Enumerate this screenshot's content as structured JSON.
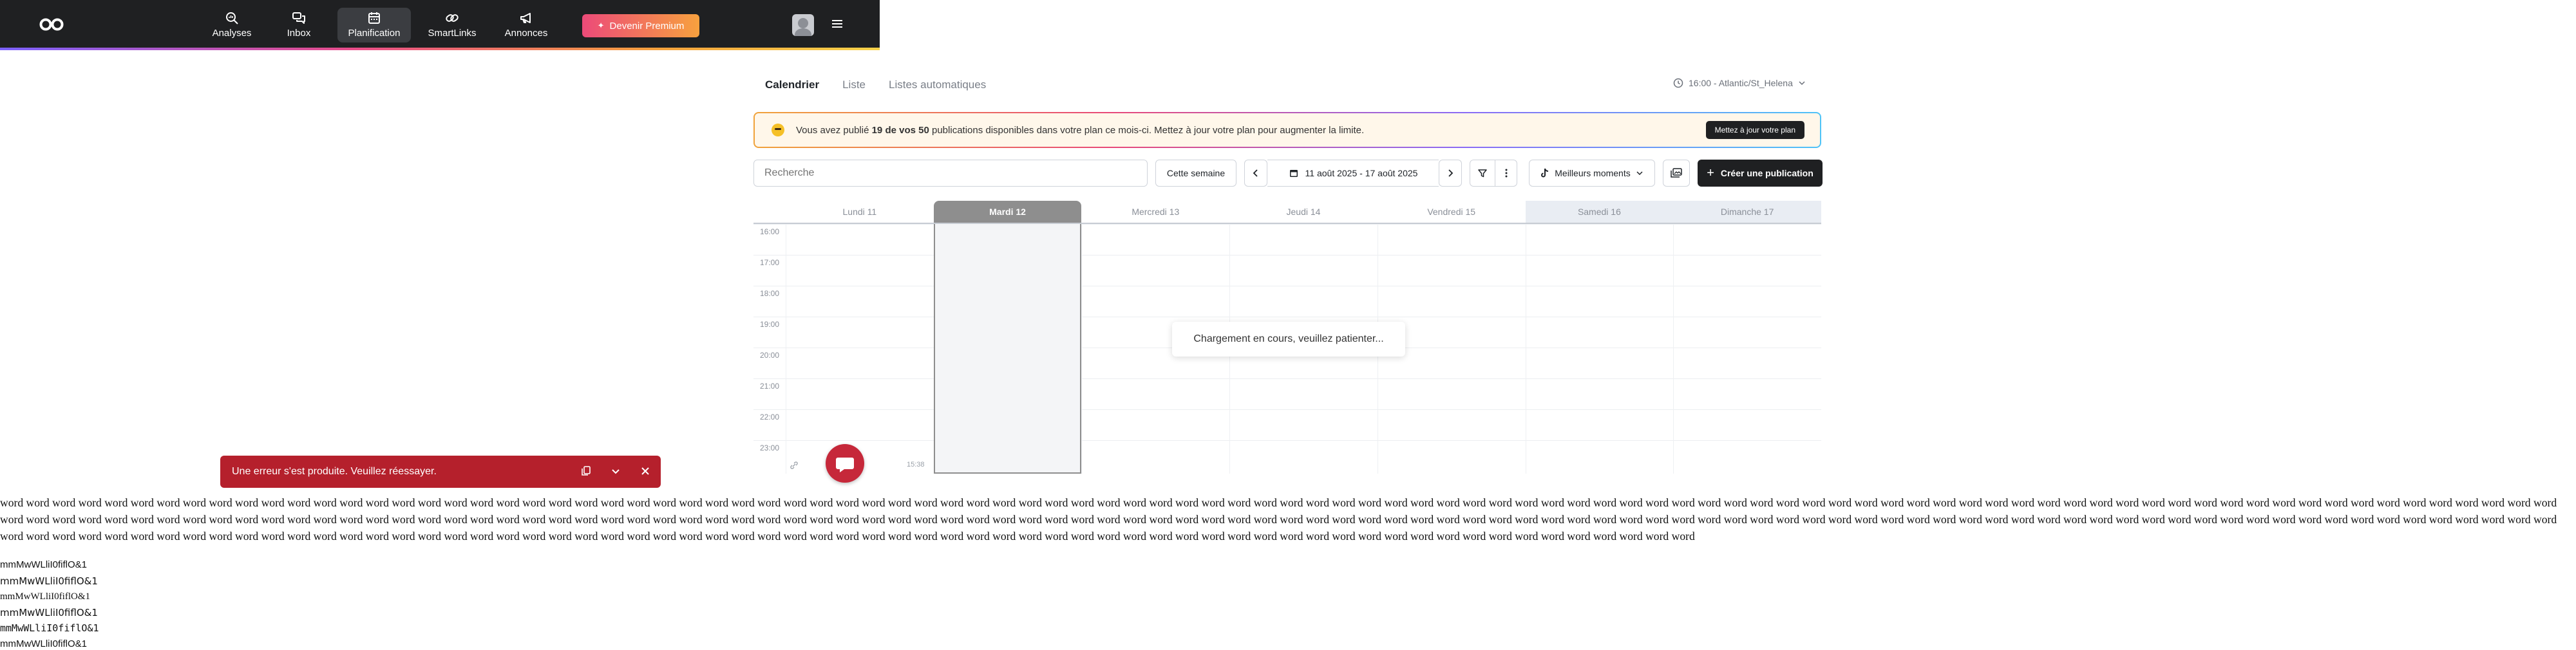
{
  "nav": {
    "items": [
      {
        "label": "Analyses",
        "icon": "zoom-chart-icon"
      },
      {
        "label": "Inbox",
        "icon": "chat-bubbles-icon"
      },
      {
        "label": "Planification",
        "icon": "calendar-icon"
      },
      {
        "label": "SmartLinks",
        "icon": "link-icon"
      },
      {
        "label": "Annonces",
        "icon": "megaphone-icon"
      }
    ],
    "premium_label": "Devenir Premium"
  },
  "tabs": [
    "Calendrier",
    "Liste",
    "Listes automatiques"
  ],
  "timezone": "16:00 - Atlantic/St_Helena",
  "banner": {
    "text_before": "Vous avez publié ",
    "text_bold": "19 de vos 50",
    "text_after": " publications disponibles dans votre plan ce mois-ci. Mettez à jour votre plan pour augmenter la limite.",
    "button": "Mettez à jour votre plan"
  },
  "toolbar": {
    "search_placeholder": "Recherche",
    "this_week": "Cette semaine",
    "date_range": "11 août 2025 - 17 août 2025",
    "best_moments": "Meilleurs moments",
    "create": "Créer une publication"
  },
  "calendar": {
    "days": [
      "Lundi 11",
      "Mardi 12",
      "Mercredi 13",
      "Jeudi 14",
      "Vendredi 15",
      "Samedi 16",
      "Dimanche 17"
    ],
    "today_index": 1,
    "weekend_indices": [
      5,
      6
    ],
    "hours": [
      "16:00",
      "17:00",
      "18:00",
      "19:00",
      "20:00",
      "21:00",
      "22:00",
      "23:00"
    ],
    "loading": "Chargement en cours, veuillez patienter...",
    "footer_time": "15:38"
  },
  "toast": {
    "message": "Une erreur s'est produite. Veuillez réessayer."
  },
  "filler_text": "word word word word word word word word word word word word word word word word word word word word word word word word word word word word word word word word word word word word word word word word word word word word word word word word word word word word word word word word word word word word word word word word word word word word word word word word word word word word word word word word word word word word word word word word word word word word word word word word word word word word word word word word word word word word word word word word word word word word word word word word word word word word word word word word word word word word word word word word word word word word word word word word word word word word word word word word word word word word word word word word word word word word word word word word word word word word word word word word word word word word word word word word word word word word word word word word word word word word word word word word word word word word word word word word word word word word word word word word word word word word word word word word word word word word word word word word word word word word word word word word word word word word word word word word word word word word word word word word word word word word word",
  "samples": [
    "mmMwWLliI0fiflO&1",
    "mmMwWLliI0fiflO&1",
    "mmMwWLliI0fiflO&1",
    "mmMwWLliI0fiflO&1",
    "mmMwWLliI0fiflO&1",
    "mmMwWLliI0fiflO&1"
  ]
}
